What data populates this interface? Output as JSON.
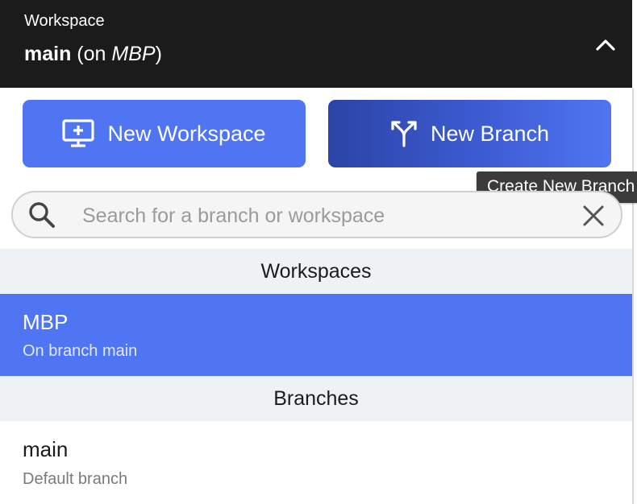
{
  "header": {
    "label": "Workspace",
    "workspace_name": "main",
    "on_prefix": " (on ",
    "host": "MBP",
    "suffix": ")",
    "icon": "chevron-up-icon"
  },
  "actions": {
    "new_workspace_label": "New Workspace",
    "new_workspace_icon": "monitor-plus-icon",
    "new_branch_label": "New Branch",
    "new_branch_icon": "branch-icon",
    "tooltip": "Create New Branch"
  },
  "search": {
    "placeholder": "Search for a branch or workspace",
    "value": "",
    "icon": "search-icon",
    "clear_icon": "close-icon"
  },
  "sections": {
    "workspaces_title": "Workspaces",
    "branches_title": "Branches"
  },
  "workspaces": [
    {
      "name": "MBP",
      "subtitle": "On branch main",
      "selected": true
    }
  ],
  "branches": [
    {
      "name": "main",
      "subtitle": "Default branch"
    }
  ],
  "colors": {
    "accent": "#5075f2",
    "accent_dark": "#2c44a6",
    "header_bg": "#1b1b1b",
    "section_bg": "#eef2f5"
  }
}
